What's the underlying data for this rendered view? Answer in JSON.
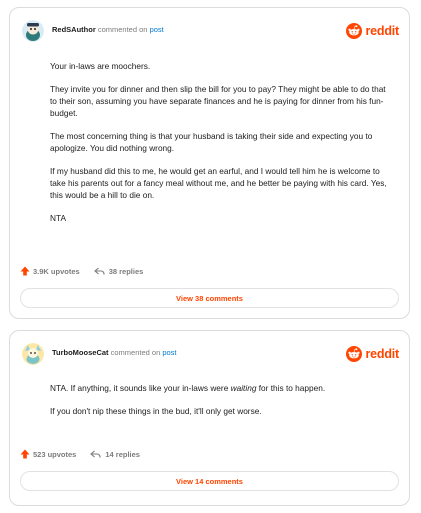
{
  "brand": {
    "wordmark": "reddit",
    "accent": "#ff4500",
    "link": "#0079d3"
  },
  "comments": [
    {
      "username": "RedSAuthor",
      "action": "commented on",
      "target": "post",
      "paragraphs": [
        "Your in-laws are moochers.",
        "They invite you for dinner and then slip the bill for you to pay? They might be able to do that to their son, assuming you have separate finances and he is paying for dinner from his fun-budget.",
        "The most concerning thing is that your husband is taking their side and expecting you to apologize. You did nothing wrong.",
        "If my husband did this to me, he would get an earful, and I would tell him he is welcome to take his parents out for a fancy meal without me, and he better be paying with his card. Yes, this would be a hill to die on.",
        "NTA"
      ],
      "upvotes": "3.9K upvotes",
      "replies": "38 replies",
      "view_label": "View 38 comments"
    },
    {
      "username": "TurboMooseCat",
      "action": "commented on",
      "target": "post",
      "p1_before": "NTA. If anything, it sounds like your in-laws were ",
      "p1_em": "waiting",
      "p1_after": " for this to happen.",
      "p2": "If you don't nip these things in the bud, it'll only get worse.",
      "upvotes": "523 upvotes",
      "replies": "14 replies",
      "view_label": "View 14 comments"
    }
  ]
}
